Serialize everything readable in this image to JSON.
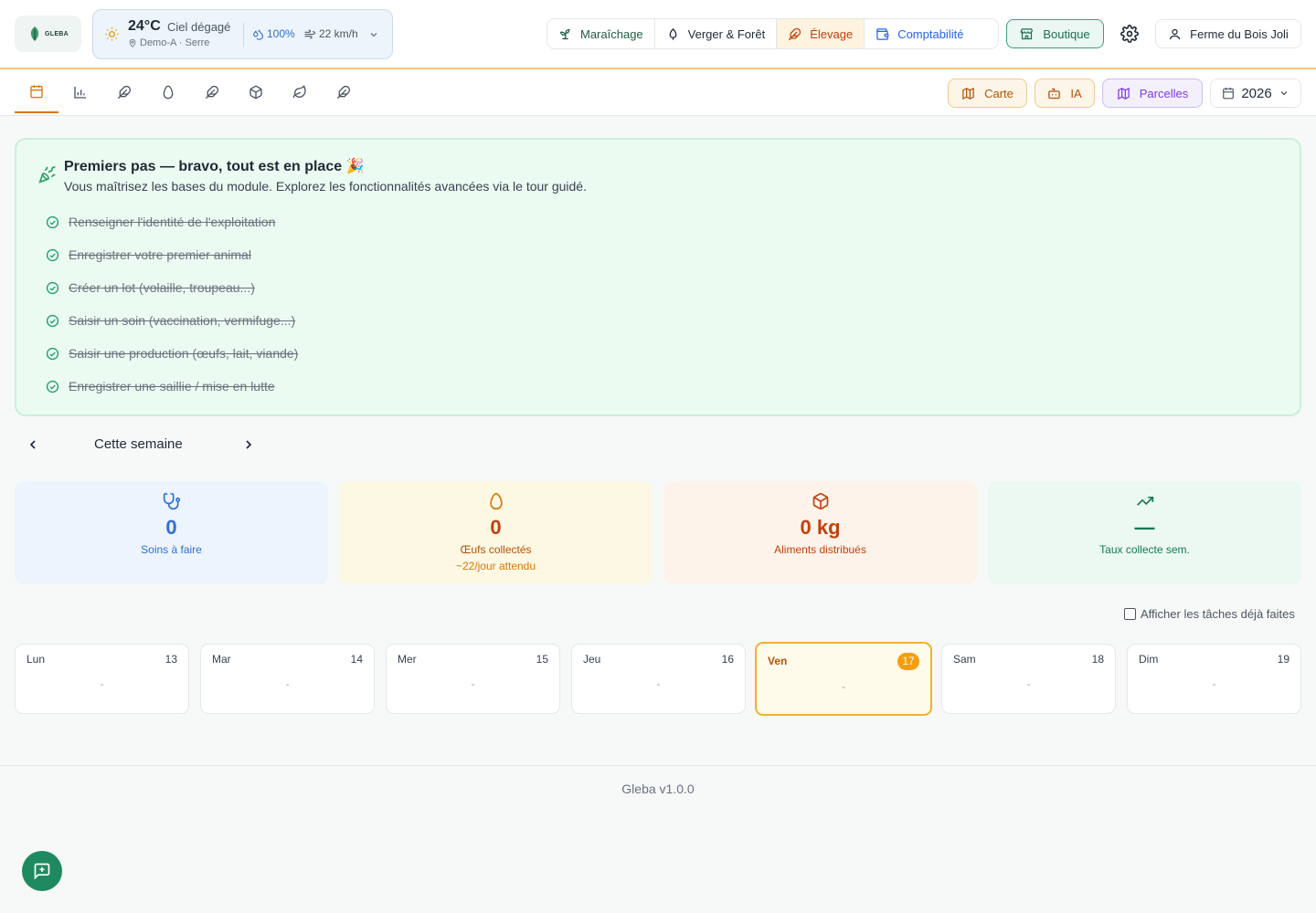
{
  "header": {
    "logo_text": "GLEBA",
    "weather": {
      "temperature": "24°C",
      "condition": "Ciel dégagé",
      "location": "Demo-A · Serre",
      "humidity": "100%",
      "wind": "22 km/h"
    },
    "modules": [
      {
        "label": "Maraîchage",
        "icon": "sprout-icon"
      },
      {
        "label": "Verger & Forêt",
        "icon": "tree-icon"
      },
      {
        "label": "Élevage",
        "icon": "feather-icon",
        "active": true
      },
      {
        "label": "Comptabilité",
        "icon": "wallet-icon"
      }
    ],
    "boutique_label": "Boutique",
    "farm_name": "Ferme du Bois Joli"
  },
  "subnav": {
    "tabs": [
      "calendar-icon",
      "bar-chart-icon",
      "feather-icon",
      "egg-icon",
      "feather-icon",
      "package-icon",
      "leaf-icon",
      "feather-icon"
    ],
    "carte_label": "Carte",
    "ia_label": "IA",
    "parcelles_label": "Parcelles",
    "year": "2026"
  },
  "onboarding": {
    "title": "Premiers pas — bravo, tout est en place 🎉",
    "subtitle": "Vous maîtrisez les bases du module. Explorez les fonctionnalités avancées via le tour guidé.",
    "items": [
      "Renseigner l'identité de l'exploitation",
      "Enregistrer votre premier animal",
      "Créer un lot (volaille, troupeau...)",
      "Saisir un soin (vaccination, vermifuge...)",
      "Saisir une production (œufs, lait, viande)",
      "Enregistrer une saillie / mise en lutte"
    ]
  },
  "week": {
    "label": "Cette semaine"
  },
  "stats": [
    {
      "value": "0",
      "label": "Soins à faire",
      "hint": "",
      "color": "#2f6fd1",
      "bg": "#edf4fd"
    },
    {
      "value": "0",
      "label": "Œufs collectés",
      "hint": "~22/jour attendu",
      "color": "#c2410c",
      "bg": "#fdf8e3"
    },
    {
      "value": "0 kg",
      "label": "Aliments distribués",
      "hint": "",
      "color": "#c2410c",
      "bg": "#fdf3ea"
    },
    {
      "value": "—",
      "label": "Taux collecte sem.",
      "hint": "",
      "color": "#157a52",
      "bg": "#ecf8f2"
    }
  ],
  "show_done_label": "Afficher les tâches déjà faites",
  "days": [
    {
      "name": "Lun",
      "num": "13",
      "content": "-"
    },
    {
      "name": "Mar",
      "num": "14",
      "content": "-"
    },
    {
      "name": "Mer",
      "num": "15",
      "content": "-"
    },
    {
      "name": "Jeu",
      "num": "16",
      "content": "-"
    },
    {
      "name": "Ven",
      "num": "17",
      "content": "-",
      "today": true
    },
    {
      "name": "Sam",
      "num": "18",
      "content": "-"
    },
    {
      "name": "Dim",
      "num": "19",
      "content": "-"
    }
  ],
  "footer": {
    "version": "Gleba v1.0.0"
  }
}
